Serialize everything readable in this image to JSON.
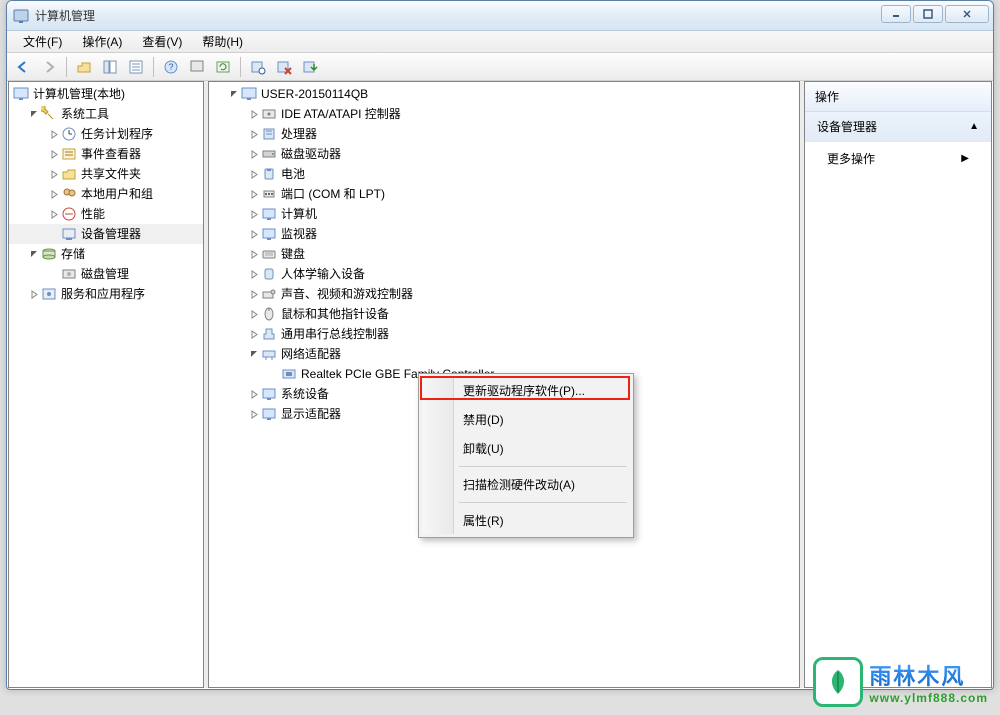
{
  "window": {
    "title": "计算机管理",
    "controls": {
      "min": "min",
      "max": "max",
      "close": "close"
    }
  },
  "menubar": [
    "文件(F)",
    "操作(A)",
    "查看(V)",
    "帮助(H)"
  ],
  "left_tree": {
    "root": "计算机管理(本地)",
    "sections": [
      {
        "label": "系统工具",
        "children": [
          "任务计划程序",
          "事件查看器",
          "共享文件夹",
          "本地用户和组",
          "性能",
          "设备管理器"
        ]
      },
      {
        "label": "存储",
        "children": [
          "磁盘管理"
        ]
      },
      {
        "label": "服务和应用程序",
        "children": []
      }
    ]
  },
  "center_tree": {
    "root": "USER-20150114QB",
    "categories": [
      "IDE ATA/ATAPI 控制器",
      "处理器",
      "磁盘驱动器",
      "电池",
      "端口 (COM 和 LPT)",
      "计算机",
      "监视器",
      "键盘",
      "人体学输入设备",
      "声音、视频和游戏控制器",
      "鼠标和其他指针设备",
      "通用串行总线控制器"
    ],
    "expanded": {
      "label": "网络适配器",
      "child": "Realtek PCIe GBE Family Controller"
    },
    "after": [
      "系统设备",
      "显示适配器"
    ]
  },
  "right_panel": {
    "header": "操作",
    "section": "设备管理器",
    "action": "更多操作"
  },
  "context_menu": {
    "items": [
      "更新驱动程序软件(P)...",
      "禁用(D)",
      "卸载(U)"
    ],
    "sep1": true,
    "items2": [
      "扫描检测硬件改动(A)"
    ],
    "sep2": true,
    "items3": [
      "属性(R)"
    ],
    "highlighted_index": 0
  },
  "watermark": {
    "main": "雨林木风",
    "sub": "www.ylmf888.com"
  }
}
